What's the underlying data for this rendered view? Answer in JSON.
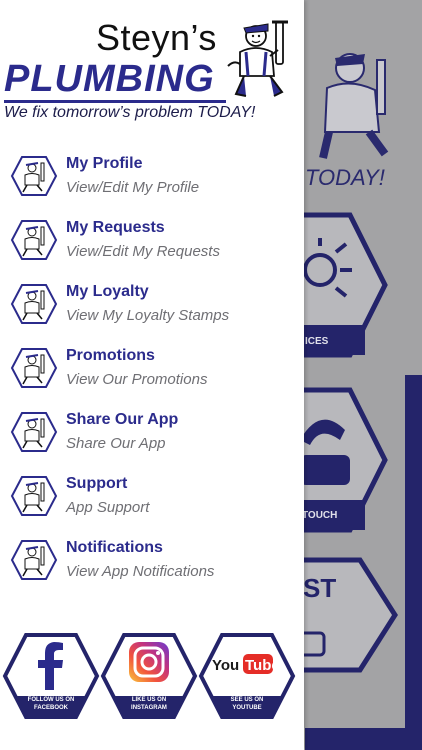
{
  "header": {
    "brand_name": "Steyn’s",
    "brand_plumbing": "PLUMBING",
    "tagline": "We fix tomorrow’s problem TODAY!"
  },
  "menu": {
    "items": [
      {
        "title": "My Profile",
        "subtitle": "View/Edit My Profile"
      },
      {
        "title": "My Requests",
        "subtitle": "View/Edit My Requests"
      },
      {
        "title": "My Loyalty",
        "subtitle": "View My Loyalty Stamps"
      },
      {
        "title": "Promotions",
        "subtitle": "View Our Promotions"
      },
      {
        "title": "Share Our App",
        "subtitle": "Share Our App"
      },
      {
        "title": "Support",
        "subtitle": "App Support"
      },
      {
        "title": "Notifications",
        "subtitle": "View App Notifications"
      }
    ]
  },
  "social": {
    "facebook": {
      "line1": "FOLLOW US ON",
      "line2": "FACEBOOK",
      "icon": "facebook-icon"
    },
    "instagram": {
      "line1": "LIKE US ON",
      "line2": "INSTAGRAM",
      "icon": "instagram-icon"
    },
    "youtube": {
      "line1": "SEE US ON",
      "line2": "YOUTUBE",
      "icon": "youtube-icon",
      "logo_you": "You",
      "logo_tube": "Tube"
    }
  },
  "background": {
    "tagline_fragment": "TODAY!",
    "hex_labels": [
      "ICES",
      "TOUCH",
      "ST"
    ]
  },
  "colors": {
    "brand_blue": "#2b2b8c",
    "dark_navy": "#24246a",
    "overlay_gray": "#a3a3a5"
  }
}
